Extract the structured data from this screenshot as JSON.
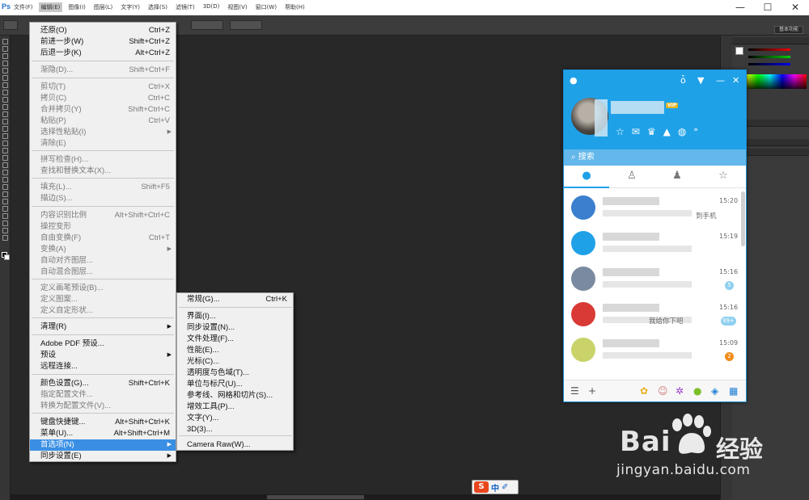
{
  "app": {
    "logo": "Ps",
    "menus": [
      "文件(F)",
      "编辑(E)",
      "图像(I)",
      "图层(L)",
      "文字(Y)",
      "选择(S)",
      "滤镜(T)",
      "3D(D)",
      "视图(V)",
      "窗口(W)",
      "帮助(H)"
    ],
    "active_menu_index": 1,
    "window_controls": [
      "—",
      "☐",
      "✕"
    ],
    "workspace": "基本功能"
  },
  "edit_menu": {
    "items": [
      {
        "label": "还原(O)",
        "shortcut": "Ctrl+Z",
        "disabled": false
      },
      {
        "label": "前进一步(W)",
        "shortcut": "Shift+Ctrl+Z",
        "disabled": false
      },
      {
        "label": "后退一步(K)",
        "shortcut": "Alt+Ctrl+Z",
        "disabled": false
      },
      {
        "label": "渐隐(D)...",
        "shortcut": "Shift+Ctrl+F",
        "disabled": true
      },
      {
        "label": "剪切(T)",
        "shortcut": "Ctrl+X",
        "disabled": true
      },
      {
        "label": "拷贝(C)",
        "shortcut": "Ctrl+C",
        "disabled": true
      },
      {
        "label": "合并拷贝(Y)",
        "shortcut": "Shift+Ctrl+C",
        "disabled": true
      },
      {
        "label": "粘贴(P)",
        "shortcut": "Ctrl+V",
        "disabled": true
      },
      {
        "label": "选择性粘贴(I)",
        "shortcut": "",
        "disabled": true,
        "submenu": true
      },
      {
        "label": "清除(E)",
        "shortcut": "",
        "disabled": true
      },
      {
        "label": "拼写检查(H)...",
        "shortcut": "",
        "disabled": true
      },
      {
        "label": "查找和替换文本(X)...",
        "shortcut": "",
        "disabled": true
      },
      {
        "label": "填充(L)...",
        "shortcut": "Shift+F5",
        "disabled": true
      },
      {
        "label": "描边(S)...",
        "shortcut": "",
        "disabled": true
      },
      {
        "label": "内容识别比例",
        "shortcut": "Alt+Shift+Ctrl+C",
        "disabled": true
      },
      {
        "label": "操控变形",
        "shortcut": "",
        "disabled": true
      },
      {
        "label": "自由变换(F)",
        "shortcut": "Ctrl+T",
        "disabled": true
      },
      {
        "label": "变换(A)",
        "shortcut": "",
        "disabled": true,
        "submenu": true
      },
      {
        "label": "自动对齐图层...",
        "shortcut": "",
        "disabled": true
      },
      {
        "label": "自动混合图层...",
        "shortcut": "",
        "disabled": true
      },
      {
        "label": "定义画笔预设(B)...",
        "shortcut": "",
        "disabled": true
      },
      {
        "label": "定义图案...",
        "shortcut": "",
        "disabled": true
      },
      {
        "label": "定义自定形状...",
        "shortcut": "",
        "disabled": true
      },
      {
        "label": "清理(R)",
        "shortcut": "",
        "disabled": false,
        "submenu": true
      },
      {
        "label": "Adobe PDF 预设...",
        "shortcut": "",
        "disabled": false
      },
      {
        "label": "预设",
        "shortcut": "",
        "disabled": false,
        "submenu": true
      },
      {
        "label": "远程连接...",
        "shortcut": "",
        "disabled": false
      },
      {
        "label": "颜色设置(G)...",
        "shortcut": "Shift+Ctrl+K",
        "disabled": false
      },
      {
        "label": "指定配置文件...",
        "shortcut": "",
        "disabled": true
      },
      {
        "label": "转换为配置文件(V)...",
        "shortcut": "",
        "disabled": true
      },
      {
        "label": "键盘快捷键...",
        "shortcut": "Alt+Shift+Ctrl+K",
        "disabled": false
      },
      {
        "label": "菜单(U)...",
        "shortcut": "Alt+Shift+Ctrl+M",
        "disabled": false
      },
      {
        "label": "首选项(N)",
        "shortcut": "",
        "disabled": false,
        "submenu": true,
        "highlighted": true
      },
      {
        "label": "同步设置(E)",
        "shortcut": "",
        "disabled": false,
        "submenu": true
      }
    ]
  },
  "preferences_submenu": {
    "items": [
      {
        "label": "常规(G)...",
        "shortcut": "Ctrl+K"
      },
      {
        "label": "界面(I)...",
        "shortcut": ""
      },
      {
        "label": "同步设置(N)...",
        "shortcut": ""
      },
      {
        "label": "文件处理(F)...",
        "shortcut": ""
      },
      {
        "label": "性能(E)...",
        "shortcut": ""
      },
      {
        "label": "光标(C)...",
        "shortcut": ""
      },
      {
        "label": "透明度与色域(T)...",
        "shortcut": ""
      },
      {
        "label": "单位与标尺(U)...",
        "shortcut": ""
      },
      {
        "label": "参考线、网格和切片(S)...",
        "shortcut": ""
      },
      {
        "label": "增效工具(P)...",
        "shortcut": ""
      },
      {
        "label": "文字(Y)...",
        "shortcut": ""
      },
      {
        "label": "3D(3)...",
        "shortcut": ""
      },
      {
        "label": "Camera Raw(W)...",
        "shortcut": ""
      }
    ]
  },
  "qq": {
    "vip": "VIP",
    "search_placeholder": "搜索",
    "conversations": [
      {
        "time": "15:20",
        "msg_visible": "到手机",
        "badge": "",
        "badge_color": "",
        "avatar_color": "#3b7fcf"
      },
      {
        "time": "15:19",
        "msg_visible": "",
        "badge": "",
        "badge_color": "",
        "avatar_color": "#1fa1e8"
      },
      {
        "time": "15:16",
        "msg_visible": "",
        "badge": "5",
        "badge_color": "#8fd0ef",
        "avatar_color": "#7a8aa0"
      },
      {
        "time": "15:16",
        "msg_visible": "我给你下吧",
        "badge": "99+",
        "badge_color": "#8fd0ef",
        "avatar_color": "#d93a35"
      },
      {
        "time": "15:09",
        "msg_visible": "",
        "badge": "2",
        "badge_color": "#f08c1a",
        "avatar_color": "#c9d36a"
      }
    ]
  },
  "ime": {
    "logo": "S",
    "mode": "中",
    "tool": "✐"
  },
  "watermark": {
    "brand": "Bai",
    "brand_cn": "经验",
    "url": "jingyan.baidu.com"
  },
  "colors": {
    "accent": "#3a8fe4",
    "qq_blue": "#1fa1e8",
    "ps_bg": "#282828"
  }
}
